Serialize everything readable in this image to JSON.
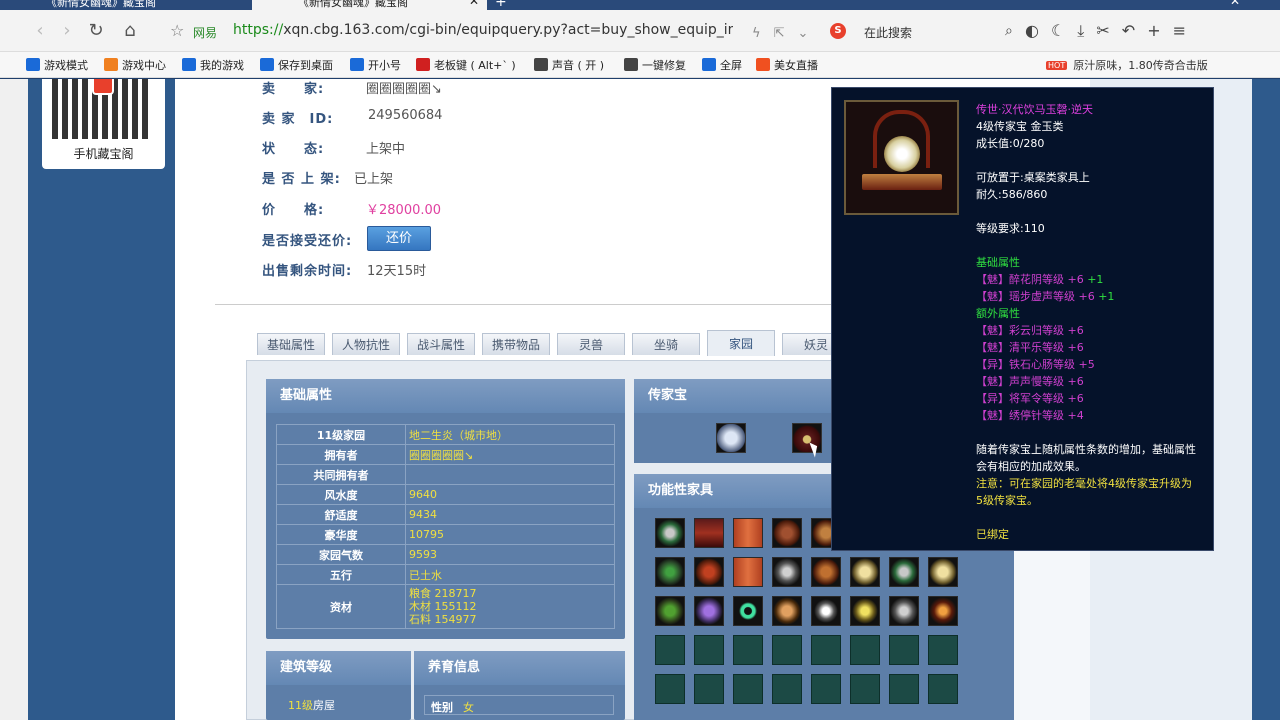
{
  "browser": {
    "tabs": [
      {
        "title": "《新倩女幽魂》藏宝阁"
      },
      {
        "title": "《新倩女幽魂》藏宝阁"
      }
    ],
    "site_tag": "网易",
    "url_https": "https://",
    "url_rest": "xqn.cbg.163.com/cgi-bin/equipquery.py?act=buy_show_equip_info&eq",
    "search_placeholder": "在此搜索",
    "bookmarks": [
      {
        "label": "游戏模式",
        "color": "#1a6ad8"
      },
      {
        "label": "游戏中心",
        "color": "#f08020"
      },
      {
        "label": "我的游戏",
        "color": "#1a6ad8"
      },
      {
        "label": "保存到桌面",
        "color": "#1a6ad8"
      },
      {
        "label": "开小号",
        "color": "#1a6ad8"
      },
      {
        "label": "老板键 ( Alt+` )",
        "color": "#d02020"
      },
      {
        "label": "声音 ( 开 )",
        "color": "#444444"
      },
      {
        "label": "一键修复",
        "color": "#444444"
      },
      {
        "label": "全屏",
        "color": "#1a6ad8"
      },
      {
        "label": "美女直播",
        "color": "#f05020"
      }
    ],
    "ad_badge": "HOT",
    "ad_text": "原汁原味，1.80传奇合击版"
  },
  "sidebar": {
    "qr_label": "手机藏宝阁"
  },
  "seller_info": {
    "seller_label": "卖　　家:",
    "seller_value": "圈圈圈圈圈↘",
    "id_label": "卖 家　ID:",
    "id_value": "249560684",
    "status_label": "状　　态:",
    "status_value": "上架中",
    "listed_label": "是 否 上 架:",
    "listed_value": "已上架",
    "price_label": "价　　格:",
    "price_value": "￥28000.00",
    "counter_label": "是否接受还价:",
    "counter_button": "还价",
    "remaining_label": "出售剩余时间:",
    "remaining_value": "12天15时"
  },
  "tabs": [
    "基础属性",
    "人物抗性",
    "战斗属性",
    "携带物品",
    "灵兽",
    "坐骑",
    "家园",
    "妖灵"
  ],
  "basic_panel": {
    "title": "基础属性",
    "rows": [
      {
        "k": "11级家园",
        "v": "地二生炎（城市地）"
      },
      {
        "k": "拥有者",
        "v": "圈圈圈圈圈↘"
      },
      {
        "k": "共同拥有者",
        "v": ""
      },
      {
        "k": "风水度",
        "v": "9640"
      },
      {
        "k": "舒适度",
        "v": "9434"
      },
      {
        "k": "豪华度",
        "v": "10795"
      },
      {
        "k": "家园气数",
        "v": "9593"
      },
      {
        "k": "五行",
        "v": "已土水"
      }
    ],
    "resources_label": "资材",
    "resources": [
      "粮食 218717",
      "木材 155112",
      "石料 154977"
    ]
  },
  "heirloom_panel": {
    "title": "传家宝"
  },
  "func_panel": {
    "title": "功能性家具"
  },
  "building_panel": {
    "title": "建筑等级",
    "row_level": "11级",
    "row_name": "房屋"
  },
  "breeding_panel": {
    "title": "养育信息",
    "row_key": "性别",
    "row_val": "女"
  },
  "tooltip": {
    "name": "传世·汉代饮马玉磬·逆天",
    "type": "4级传家宝 金玉类",
    "growth": "成长值:0/280",
    "placement": "可放置于:桌案类家具上",
    "durability": "耐久:586/860",
    "level_req": "等级要求:110",
    "basic_title": "基础属性",
    "basic_attrs": [
      {
        "text": "【魅】醉花阴等级 +6",
        "plus": "+1"
      },
      {
        "text": "【魅】瑶步虚声等级 +6",
        "plus": "+1"
      }
    ],
    "extra_title": "额外属性",
    "extra_attrs": [
      "【魅】彩云归等级 +6",
      "【魅】清平乐等级 +6",
      "【异】铁石心肠等级 +5",
      "【魅】声声慢等级 +6",
      "【异】将军令等级 +6",
      "【魅】绣停针等级 +4"
    ],
    "note1": "随着传家宝上随机属性条数的增加，基础属性",
    "note2": "会有相应的加成效果。",
    "note3": "注意：可在家园的老毫处将4级传家宝升级为",
    "note4": "5级传家宝。",
    "bound": "已绑定"
  }
}
